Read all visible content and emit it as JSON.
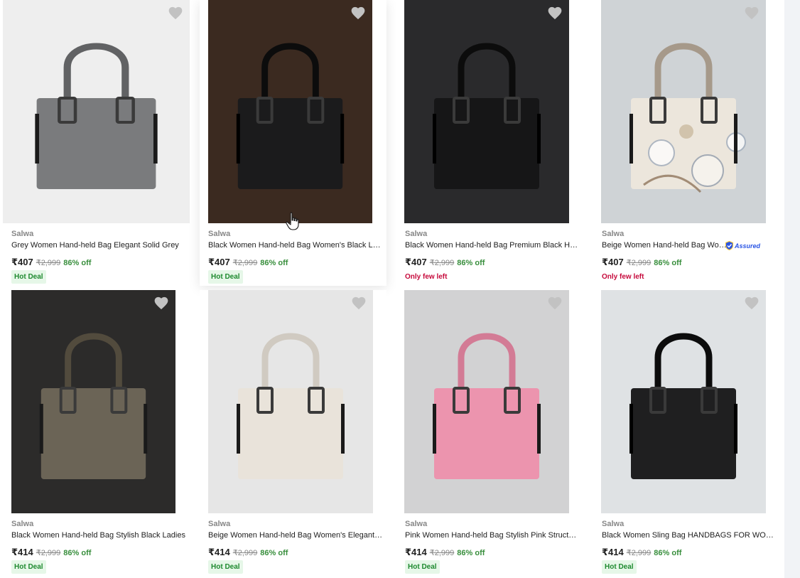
{
  "colors": {
    "price_off": "#388e3c",
    "hot_deal_bg": "#e6f7e8",
    "hot_deal_text": "#1e8a2f",
    "few_left_text": "#c6093b",
    "wishlist_icon": "#c2c2c2"
  },
  "icons": {
    "wishlist": "heart-icon",
    "assured": "flipkart-assured-icon",
    "cursor": "hand-pointer-icon"
  },
  "products": [
    {
      "brand": "Salwa",
      "title": "Grey Women Hand-held Bag Elegant Solid Grey",
      "price": "₹407",
      "mrp": "₹2,999",
      "off": "86% off",
      "badge": "Hot Deal",
      "badge_type": "deal",
      "assured": false,
      "bag_color": "#7a7b7d"
    },
    {
      "brand": "Salwa",
      "title": "Black Women Hand-held Bag Women's Black Leather",
      "price": "₹407",
      "mrp": "₹2,999",
      "off": "86% off",
      "badge": "Hot Deal",
      "badge_type": "deal",
      "assured": false,
      "bag_color": "#1b1b1c"
    },
    {
      "brand": "Salwa",
      "title": "Black Women Hand-held Bag Premium Black Handbag",
      "price": "₹407",
      "mrp": "₹2,999",
      "off": "86% off",
      "badge": "Only few left",
      "badge_type": "few",
      "assured": false,
      "bag_color": "#161617"
    },
    {
      "brand": "Salwa",
      "title": "Beige Women Hand-held Bag Women's Floral",
      "price": "₹407",
      "mrp": "₹2,999",
      "off": "86% off",
      "badge": "Only few left",
      "badge_type": "few",
      "assured": true,
      "assured_label": "Assured",
      "bag_color": "#ece6dc"
    },
    {
      "brand": "Salwa",
      "title": "Black Women Hand-held Bag Stylish Black Ladies",
      "price": "₹414",
      "mrp": "₹2,999",
      "off": "86% off",
      "badge": "Hot Deal",
      "badge_type": "deal",
      "assured": false,
      "bag_color": "#6b6456"
    },
    {
      "brand": "Salwa",
      "title": "Beige Women Hand-held Bag Women's Elegant Beige",
      "price": "₹414",
      "mrp": "₹2,999",
      "off": "86% off",
      "badge": "Hot Deal",
      "badge_type": "deal",
      "assured": false,
      "bag_color": "#e9e3da"
    },
    {
      "brand": "Salwa",
      "title": "Pink Women Hand-held Bag Stylish Pink Structured",
      "price": "₹414",
      "mrp": "₹2,999",
      "off": "86% off",
      "badge": "Hot Deal",
      "badge_type": "deal",
      "assured": false,
      "bag_color": "#ec94ae"
    },
    {
      "brand": "Salwa",
      "title": "Black Women Sling Bag HANDBAGS FOR WOMEN",
      "price": "₹414",
      "mrp": "₹2,999",
      "off": "86% off",
      "badge": "Hot Deal",
      "badge_type": "deal",
      "assured": false,
      "bag_color": "#1f1f20"
    }
  ]
}
